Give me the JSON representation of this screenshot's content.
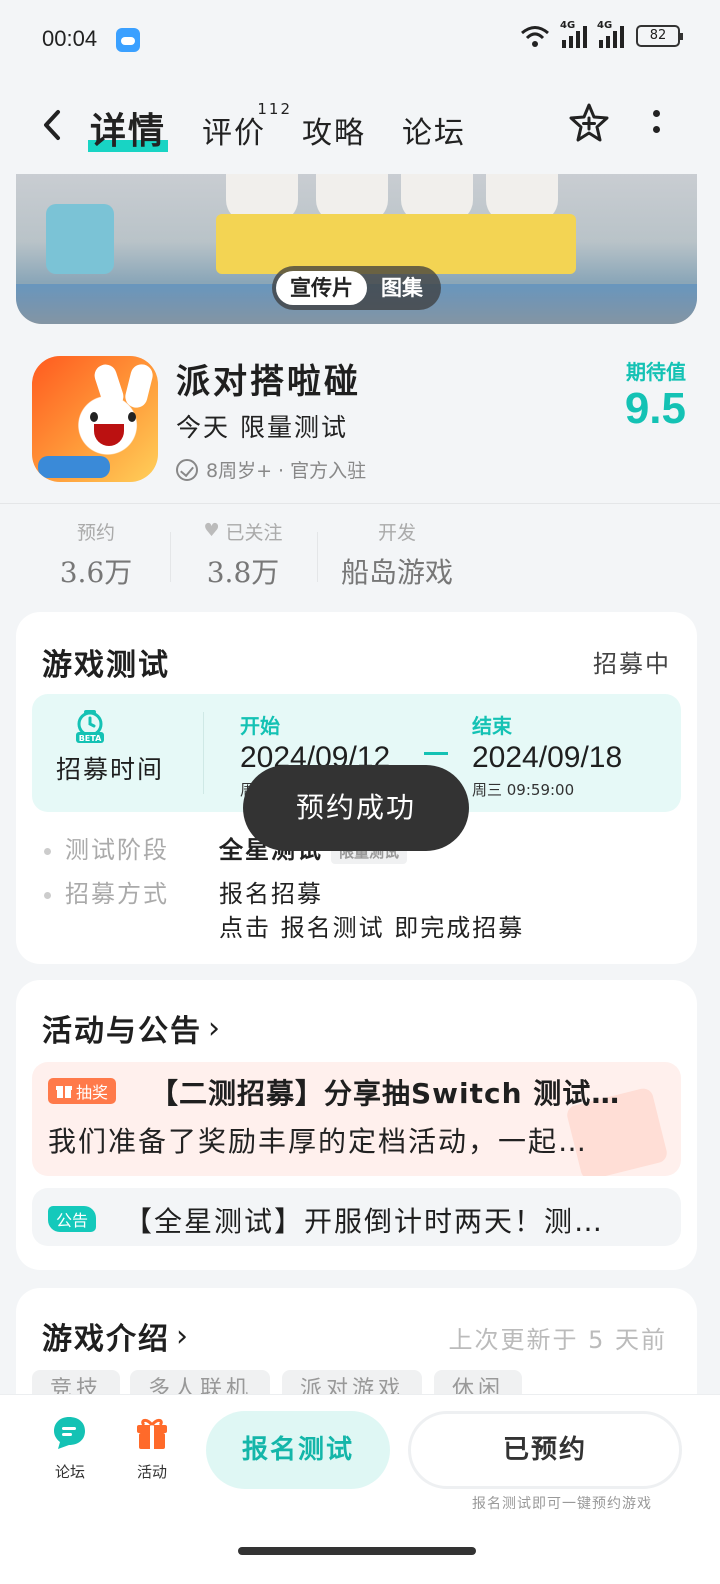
{
  "status_bar": {
    "time": "00:04",
    "network1": "4G",
    "network2": "4G",
    "battery": "82"
  },
  "nav": {
    "tabs": [
      {
        "label": "详情",
        "active": true
      },
      {
        "label": "评价",
        "count": "112"
      },
      {
        "label": "攻略"
      },
      {
        "label": "论坛"
      }
    ],
    "icons": [
      "back-chevron-icon",
      "star-add-icon",
      "more-vertical-icon"
    ]
  },
  "banner": {
    "tabs": [
      "宣传片",
      "图集"
    ],
    "selected": "宣传片"
  },
  "game": {
    "name": "派对搭啦碰",
    "status": "今天 限量测试",
    "meta": "8周岁+ · 官方入驻",
    "expect_label": "期待值",
    "expect_value": "9.5",
    "accent_color": "#14c2b4"
  },
  "stats": [
    {
      "label": "预约",
      "value": "3.6万"
    },
    {
      "label": "已关注",
      "value": "3.8万"
    },
    {
      "label": "开发",
      "value": "船岛游戏"
    }
  ],
  "test_card": {
    "title": "游戏测试",
    "state": "招募中",
    "recruit_label": "招募时间",
    "start_label": "开始",
    "start_date": "2024/09/12",
    "start_sub": "周",
    "end_label": "结束",
    "end_date": "2024/09/18",
    "end_sub": "周三 09:59:00",
    "info": [
      {
        "key": "测试阶段",
        "value": "全星测试",
        "tag": "限量测试"
      },
      {
        "key": "招募方式",
        "value": "报名招募",
        "value2": "点击 报名测试 即完成招募"
      }
    ]
  },
  "toast": "预约成功",
  "news_card": {
    "title": "活动与公告",
    "items": [
      {
        "badge": "抽奖",
        "title": "【二测招募】分享抽Switch 测试…",
        "desc": "我们准备了奖励丰厚的定档活动，一起…"
      },
      {
        "badge": "公告",
        "title": "【全星测试】开服倒计时两天！测…"
      }
    ]
  },
  "intro_card": {
    "title": "游戏介绍",
    "updated": "上次更新于 5 天前",
    "tags": [
      "竞技",
      "多人联机",
      "派对游戏",
      "休闲"
    ]
  },
  "bottom_bar": {
    "forum_label": "论坛",
    "activity_label": "活动",
    "test_button": "报名测试",
    "reserved_button": "已预约",
    "hint": "报名测试即可一键预约游戏"
  }
}
